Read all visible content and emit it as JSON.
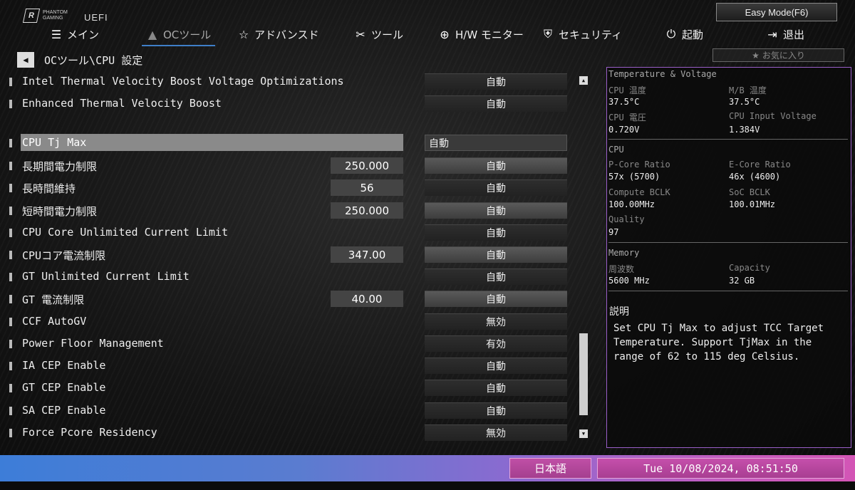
{
  "header": {
    "logo_mark": "R",
    "logo_text": "PHANTOM GAMING",
    "uefi": "UEFI",
    "easy_mode": "Easy Mode(F6)"
  },
  "nav": [
    {
      "label": "メイン",
      "icon": "list-icon",
      "glyph": "☰"
    },
    {
      "label": "OCツール",
      "icon": "rocket-icon",
      "glyph": "🚀"
    },
    {
      "label": "アドバンスド",
      "icon": "star-icon",
      "glyph": "☆"
    },
    {
      "label": "ツール",
      "icon": "wrench-icon",
      "glyph": "✂"
    },
    {
      "label": "H/W モニター",
      "icon": "crosshair-icon",
      "glyph": "⊕"
    },
    {
      "label": "セキュリティ",
      "icon": "shield-icon",
      "glyph": "⛨"
    },
    {
      "label": "起動",
      "icon": "power-icon",
      "glyph": "⏻"
    },
    {
      "label": "退出",
      "icon": "exit-icon",
      "glyph": "⇥"
    }
  ],
  "breadcrumb": "OCツール\\CPU 設定",
  "favorites": "お気に入り",
  "settings": [
    {
      "label": "Intel Thermal Velocity Boost Voltage Optimizations",
      "number": null,
      "value": "自動"
    },
    {
      "label": "Enhanced Thermal Velocity Boost",
      "number": null,
      "value": "自動"
    },
    {
      "label": "CPU Tj Max",
      "number": null,
      "value": "自動"
    },
    {
      "label": "長期間電力制限",
      "number": "250.000",
      "value": "自動"
    },
    {
      "label": "長時間維持",
      "number": "56",
      "value": "自動"
    },
    {
      "label": "短時間電力制限",
      "number": "250.000",
      "value": "自動"
    },
    {
      "label": "CPU Core Unlimited Current Limit",
      "number": null,
      "value": "自動"
    },
    {
      "label": "CPUコア電流制限",
      "number": "347.00",
      "value": "自動"
    },
    {
      "label": "GT Unlimited Current Limit",
      "number": null,
      "value": "自動"
    },
    {
      "label": "GT 電流制限",
      "number": "40.00",
      "value": "自動"
    },
    {
      "label": "CCF AutoGV",
      "number": null,
      "value": "無効"
    },
    {
      "label": "Power Floor Management",
      "number": null,
      "value": "有効"
    },
    {
      "label": "IA CEP Enable",
      "number": null,
      "value": "自動"
    },
    {
      "label": "GT CEP Enable",
      "number": null,
      "value": "自動"
    },
    {
      "label": "SA CEP Enable",
      "number": null,
      "value": "自動"
    },
    {
      "label": "Force Pcore Residency",
      "number": null,
      "value": "無効"
    }
  ],
  "monitor": {
    "temp_title": "Temperature & Voltage",
    "cpu_temp_label": "CPU 温度",
    "cpu_temp": "37.5°C",
    "mb_temp_label": "M/B 温度",
    "mb_temp": "37.5°C",
    "cpu_voltage_label": "CPU 電圧",
    "cpu_voltage": "0.720V",
    "cpu_input_label": "CPU Input Voltage",
    "cpu_input": "1.384V",
    "cpu_title": "CPU",
    "pcore_label": "P-Core Ratio",
    "pcore": "57x (5700)",
    "ecore_label": "E-Core Ratio",
    "ecore": "46x (4600)",
    "compute_bclk_label": "Compute BCLK",
    "compute_bclk": "100.00MHz",
    "soc_bclk_label": "SoC BCLK",
    "soc_bclk": "100.01MHz",
    "quality_label": "Quality",
    "quality": "97",
    "memory_title": "Memory",
    "freq_label": "周波数",
    "freq": "5600 MHz",
    "capacity_label": "Capacity",
    "capacity": "32 GB"
  },
  "description": {
    "title": "説明",
    "text": "Set CPU Tj Max to adjust TCC Target Temperature. Support TjMax in the range of 62 to 115 deg Celsius."
  },
  "footer": {
    "language": "日本語",
    "datetime": "Tue 10/08/2024, 08:51:50"
  },
  "colors": {
    "accent_blue": "#3f7fc8",
    "panel_border": "#9a5fc9",
    "footer_pink": "#c54fab"
  }
}
